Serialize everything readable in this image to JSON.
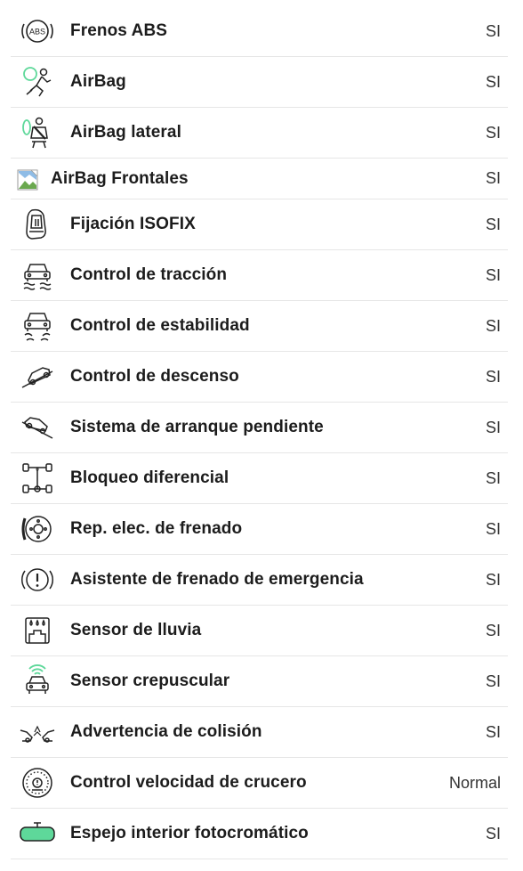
{
  "colors": {
    "text": "#1c1c1c",
    "value": "#333333",
    "divider": "#e6e6e6",
    "accent_green": "#5ed89a"
  },
  "features": [
    {
      "icon": "abs-icon",
      "label": "Frenos ABS",
      "value": "SI"
    },
    {
      "icon": "airbag-icon",
      "label": "AirBag",
      "value": "SI"
    },
    {
      "icon": "side-airbag-icon",
      "label": "AirBag lateral",
      "value": "SI"
    },
    {
      "icon": "broken-image-icon",
      "label": "AirBag Frontales",
      "value": "SI"
    },
    {
      "icon": "isofix-icon",
      "label": "Fijación ISOFIX",
      "value": "SI"
    },
    {
      "icon": "traction-control-icon",
      "label": "Control de tracción",
      "value": "SI"
    },
    {
      "icon": "stability-control-icon",
      "label": "Control de estabilidad",
      "value": "SI"
    },
    {
      "icon": "descent-control-icon",
      "label": "Control de descenso",
      "value": "SI"
    },
    {
      "icon": "hill-start-icon",
      "label": "Sistema de arranque pendiente",
      "value": "SI"
    },
    {
      "icon": "differential-lock-icon",
      "label": "Bloqueo diferencial",
      "value": "SI"
    },
    {
      "icon": "brake-distribution-icon",
      "label": "Rep. elec. de frenado",
      "value": "SI"
    },
    {
      "icon": "emergency-brake-icon",
      "label": "Asistente de frenado de emergencia",
      "value": "SI"
    },
    {
      "icon": "rain-sensor-icon",
      "label": "Sensor de lluvia",
      "value": "SI"
    },
    {
      "icon": "twilight-sensor-icon",
      "label": "Sensor crepuscular",
      "value": "SI"
    },
    {
      "icon": "collision-warning-icon",
      "label": "Advertencia de colisión",
      "value": "SI"
    },
    {
      "icon": "cruise-control-icon",
      "label": "Control velocidad de crucero",
      "value": "Normal"
    },
    {
      "icon": "auto-dimming-mirror-icon",
      "label": "Espejo interior fotocromático",
      "value": "SI"
    }
  ]
}
